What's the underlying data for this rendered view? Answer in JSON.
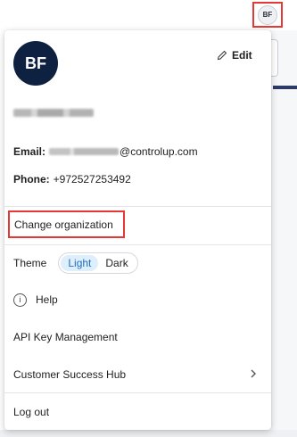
{
  "topbar": {
    "avatar_initials": "BF"
  },
  "profile": {
    "avatar_initials": "BF",
    "edit_label": "Edit",
    "email_label": "Email:",
    "email_domain": "@controlup.com",
    "phone_label": "Phone:",
    "phone_value": "+972527253492"
  },
  "menu": {
    "change_org_label": "Change organization",
    "theme_label": "Theme",
    "theme_options": {
      "light": "Light",
      "dark": "Dark"
    },
    "theme_selected": "Light",
    "help_label": "Help",
    "api_keys_label": "API Key Management",
    "success_hub_label": "Customer Success Hub",
    "logout_label": "Log out"
  },
  "colors": {
    "highlight_border": "#e53935",
    "avatar_bg": "#0f2141",
    "active_theme_bg": "#dfeefb",
    "active_theme_text": "#1c6fc4"
  },
  "icons": {
    "edit": "pencil-icon",
    "help": "info-icon",
    "submenu": "chevron-right-icon"
  }
}
